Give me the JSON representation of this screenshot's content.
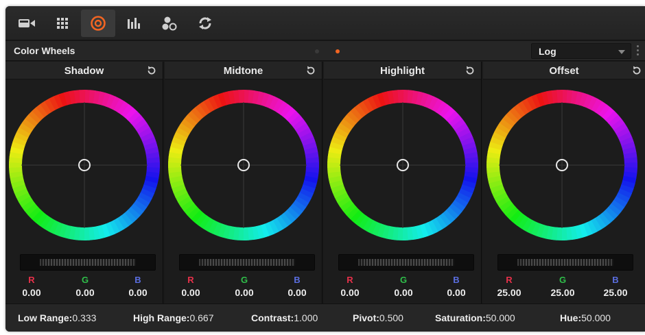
{
  "toolbar": {
    "tools": [
      {
        "icon": "camera-icon"
      },
      {
        "icon": "grid-icon"
      },
      {
        "icon": "color-wheel-icon",
        "active": true
      },
      {
        "icon": "bars-icon"
      },
      {
        "icon": "nodes-icon"
      },
      {
        "icon": "sync-icon"
      }
    ],
    "accent": "#f26522"
  },
  "header": {
    "title": "Color Wheels",
    "pages": [
      {
        "active": false
      },
      {
        "active": true
      }
    ],
    "mode": {
      "value": "Log"
    }
  },
  "wheels": [
    {
      "name": "Shadow",
      "r_label": "R",
      "g_label": "G",
      "b_label": "B",
      "r": "0.00",
      "g": "0.00",
      "b": "0.00"
    },
    {
      "name": "Midtone",
      "r_label": "R",
      "g_label": "G",
      "b_label": "B",
      "r": "0.00",
      "g": "0.00",
      "b": "0.00"
    },
    {
      "name": "Highlight",
      "r_label": "R",
      "g_label": "G",
      "b_label": "B",
      "r": "0.00",
      "g": "0.00",
      "b": "0.00"
    },
    {
      "name": "Offset",
      "r_label": "R",
      "g_label": "G",
      "b_label": "B",
      "r": "25.00",
      "g": "25.00",
      "b": "25.00"
    }
  ],
  "channel_colors": {
    "r": "#e8304a",
    "g": "#2fbf4a",
    "b": "#5a6ee0"
  },
  "footer": {
    "low_range_label": "Low Range:",
    "low_range_value": "0.333",
    "high_range_label": "High Range:",
    "high_range_value": "0.667",
    "contrast_label": "Contrast:",
    "contrast_value": "1.000",
    "pivot_label": "Pivot:",
    "pivot_value": "0.500",
    "saturation_label": "Saturation:",
    "saturation_value": "50.000",
    "hue_label": "Hue:",
    "hue_value": "50.000"
  }
}
